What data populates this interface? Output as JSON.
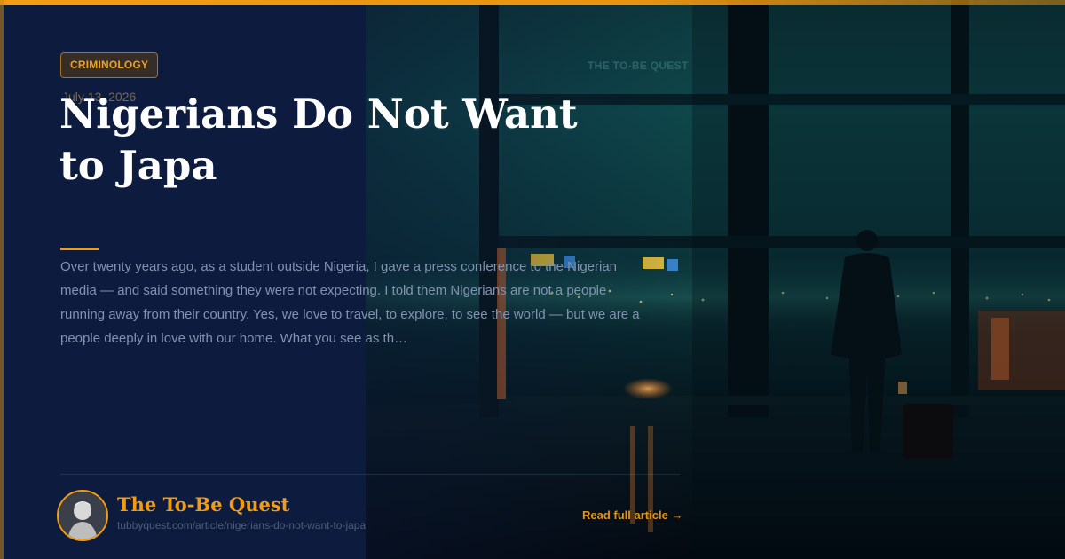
{
  "category": "CRIMINOLOGY",
  "date": "July 13, 2026",
  "watermark": "THE TO-BE QUEST",
  "title": "Nigerians Do Not Want to Japa",
  "excerpt": "Over twenty years ago, as a student outside Nigeria, I gave a press conference to the Nigerian media — and said something they were not expecting. I told them Nigerians are not a people running away from their country. Yes, we love to travel, to explore, to see the world — but we are a people deeply in love with our home. What you see as th…",
  "site": {
    "name": "The To-Be Quest",
    "url": "tubbyquest.com/article/nigerians-do-not-want-to-japa"
  },
  "cta": "Read full article →",
  "colors": {
    "accent": "#f39c12",
    "panel": "#0d1b3e",
    "title": "#ffffff",
    "excerpt": "#8293b0"
  },
  "icons": {
    "avatar": "portrait-avatar-icon",
    "arrow": "right-arrow"
  }
}
